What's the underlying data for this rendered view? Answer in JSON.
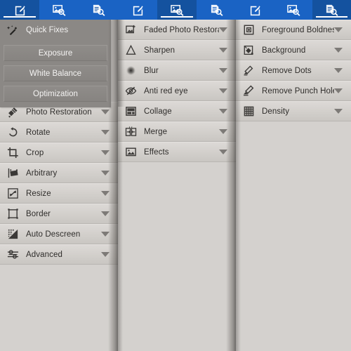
{
  "tabs": {
    "icons": [
      "edit-pencil-square-icon",
      "image-search-icon",
      "document-search-icon"
    ],
    "panel1_active_index": 0,
    "panel2_active_index": 1,
    "panel3_active_index": 2,
    "bar_color": "#1a63c4",
    "active_color": "#14529f",
    "underline_color": "#ffffff"
  },
  "quick_fixes": {
    "icon": "magic-wand-icon",
    "title": "Quick Fixes",
    "panel_color": "#8b8885",
    "buttons": [
      {
        "label": "Exposure"
      },
      {
        "label": "White Balance"
      },
      {
        "label": "Optimization"
      }
    ]
  },
  "panel1": {
    "items": [
      {
        "label": "Photo Restoration",
        "icon": "restoration-brush-icon",
        "chevron": "chevron-down-icon"
      },
      {
        "label": "Rotate",
        "icon": "rotate-ccw-icon",
        "chevron": "chevron-down-icon"
      },
      {
        "label": "Crop",
        "icon": "crop-icon",
        "chevron": "chevron-down-icon"
      },
      {
        "label": "Arbitrary",
        "icon": "arbitrary-rotate-icon",
        "chevron": "chevron-down-icon"
      },
      {
        "label": "Resize",
        "icon": "resize-diagonal-icon",
        "chevron": "chevron-down-icon"
      },
      {
        "label": "Border",
        "icon": "border-frame-icon",
        "chevron": "chevron-down-icon"
      },
      {
        "label": "Auto Descreen",
        "icon": "descreen-halftone-icon",
        "chevron": "chevron-down-icon"
      },
      {
        "label": "Advanced",
        "icon": "sliders-advanced-icon",
        "chevron": "chevron-down-icon"
      }
    ]
  },
  "panel2": {
    "items": [
      {
        "label": "Faded Photo Restoration",
        "icon": "faded-photo-plus-icon",
        "chevron": "chevron-down-icon"
      },
      {
        "label": "Sharpen",
        "icon": "sharpen-triangle-icon",
        "chevron": "chevron-down-icon"
      },
      {
        "label": "Blur",
        "icon": "blur-dot-icon",
        "chevron": "chevron-down-icon"
      },
      {
        "label": "Anti red eye",
        "icon": "eye-slash-icon",
        "chevron": "chevron-down-icon"
      },
      {
        "label": "Collage",
        "icon": "collage-layout-icon",
        "chevron": "chevron-down-icon"
      },
      {
        "label": "Merge",
        "icon": "merge-panels-icon",
        "chevron": "chevron-down-icon"
      },
      {
        "label": "Effects",
        "icon": "effects-picture-icon",
        "chevron": "chevron-down-icon"
      }
    ]
  },
  "panel3": {
    "items": [
      {
        "label": "Foreground Boldness",
        "icon": "foreground-square-icon",
        "chevron": "chevron-down-icon"
      },
      {
        "label": "Background",
        "icon": "paint-bucket-icon",
        "chevron": "chevron-down-icon"
      },
      {
        "label": "Remove Dots",
        "icon": "eraser-small-icon",
        "chevron": "chevron-down-icon"
      },
      {
        "label": "Remove Punch Hole",
        "icon": "eraser-large-icon",
        "chevron": "chevron-down-icon"
      },
      {
        "label": "Density",
        "icon": "density-grid-icon",
        "chevron": "chevron-down-icon"
      }
    ]
  }
}
